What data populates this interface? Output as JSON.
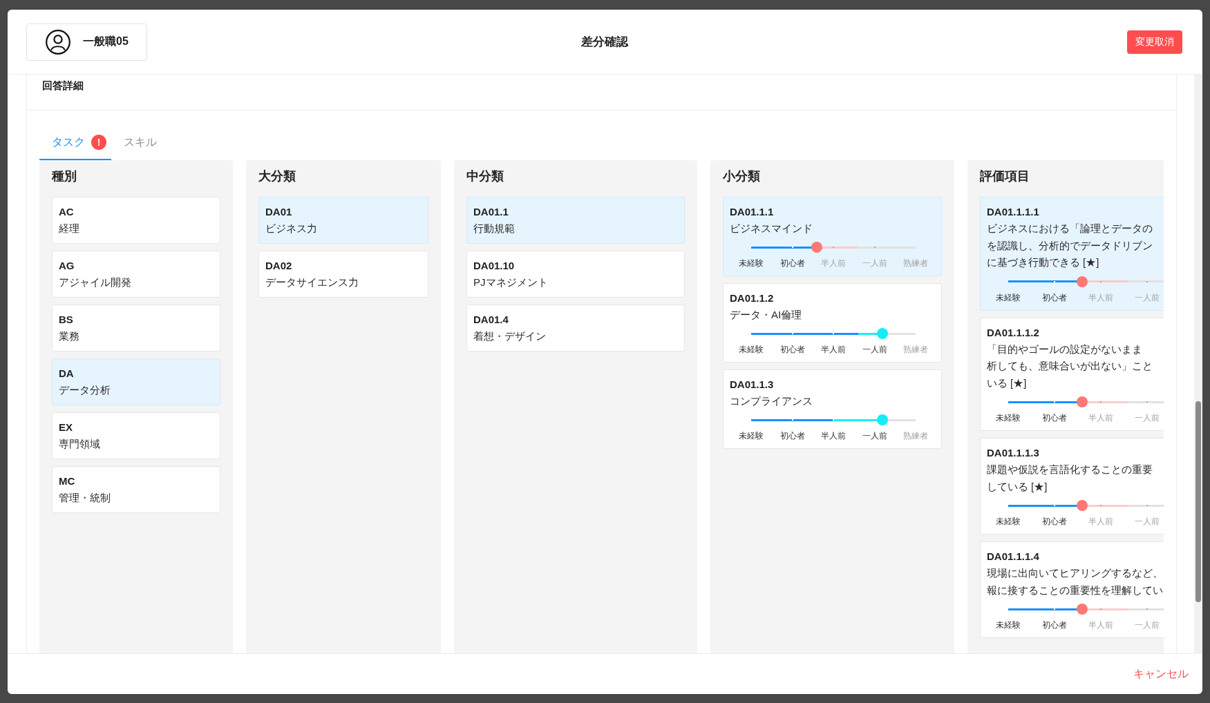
{
  "dialog": {
    "user": {
      "name": "一般職05"
    },
    "title": "差分確認",
    "revert_button": "変更取消"
  },
  "section": {
    "title": "回答詳細",
    "tabs": [
      {
        "label": "タスク",
        "selected": true,
        "badge": "!"
      },
      {
        "label": "スキル",
        "selected": false
      }
    ],
    "columns": [
      {
        "title": "種別",
        "kind": "plain",
        "items": [
          {
            "code": "AC",
            "name": "経理",
            "selected": false
          },
          {
            "code": "AG",
            "name": "アジャイル開発",
            "selected": false
          },
          {
            "code": "BS",
            "name": "業務",
            "selected": false
          },
          {
            "code": "DA",
            "name": "データ分析",
            "selected": true
          },
          {
            "code": "EX",
            "name": "専門領域",
            "selected": false
          },
          {
            "code": "MC",
            "name": "管理・統制",
            "selected": false
          }
        ]
      },
      {
        "title": "大分類",
        "kind": "plain",
        "items": [
          {
            "code": "DA01",
            "name": "ビジネス力",
            "selected": true
          },
          {
            "code": "DA02",
            "name": "データサイエンス力",
            "selected": false
          }
        ]
      },
      {
        "title": "中分類",
        "kind": "plain",
        "items": [
          {
            "code": "DA01.1",
            "name": "行動規範",
            "selected": true
          },
          {
            "code": "DA01.10",
            "name": "PJマネジメント",
            "selected": false
          },
          {
            "code": "DA01.4",
            "name": "着想・デザイン",
            "selected": false
          }
        ]
      },
      {
        "title": "小分類",
        "kind": "rated",
        "items": [
          {
            "code": "DA01.1.1",
            "name": "ビジネスマインド",
            "selected": true,
            "rating": {
              "level": 0.4,
              "previous": {
                "level": 0.65
              },
              "labels": [
                "未経験",
                "初心者",
                "半人前",
                "一人前",
                "熟練者"
              ]
            }
          },
          {
            "code": "DA01.1.2",
            "name": "データ・AI倫理",
            "selected": false,
            "rating": {
              "level": 0.8,
              "previous": {
                "level": 0.65
              },
              "labels": [
                "未経験",
                "初心者",
                "半人前",
                "一人前",
                "熟練者"
              ]
            }
          },
          {
            "code": "DA01.1.3",
            "name": "コンプライアンス",
            "selected": false,
            "rating": {
              "level": 0.8,
              "previous": {
                "level": 0.5
              },
              "labels": [
                "未経験",
                "初心者",
                "半人前",
                "一人前",
                "熟練者"
              ]
            }
          }
        ]
      },
      {
        "title": "評価項目",
        "kind": "rated",
        "items": [
          {
            "code": "DA01.1.1.1",
            "lines": [
              "ビジネスにおける「論理とデータの",
              "を認識し、分析的でデータドリブン",
              "に基づき行動できる [★]"
            ],
            "selected": true,
            "rating": {
              "level": 0.4,
              "previous": {
                "level": 0.65
              },
              "labels": [
                "未経験",
                "初心者",
                "半人前",
                "一人前"
              ]
            }
          },
          {
            "code": "DA01.1.1.2",
            "lines": [
              "「目的やゴールの設定がないまま",
              "析しても、意味合いが出ない」こと",
              "いる [★]"
            ],
            "selected": false,
            "rating": {
              "level": 0.4,
              "previous": {
                "level": 0.65
              },
              "labels": [
                "未経験",
                "初心者",
                "半人前",
                "一人前"
              ]
            }
          },
          {
            "code": "DA01.1.1.3",
            "lines": [
              "課題や仮説を言語化することの重要",
              "している [★]"
            ],
            "selected": false,
            "rating": {
              "level": 0.4,
              "previous": {
                "level": 0.65
              },
              "labels": [
                "未経験",
                "初心者",
                "半人前",
                "一人前"
              ]
            }
          },
          {
            "code": "DA01.1.1.4",
            "lines": [
              "現場に出向いてヒアリングするなど、",
              "報に接することの重要性を理解してい"
            ],
            "selected": false,
            "rating": {
              "level": 0.4,
              "previous": {
                "level": 0.65
              },
              "labels": [
                "未経験",
                "初心者",
                "半人前",
                "一人前"
              ]
            }
          }
        ]
      }
    ]
  },
  "footer": {
    "cancel_button": "キャンセル"
  }
}
